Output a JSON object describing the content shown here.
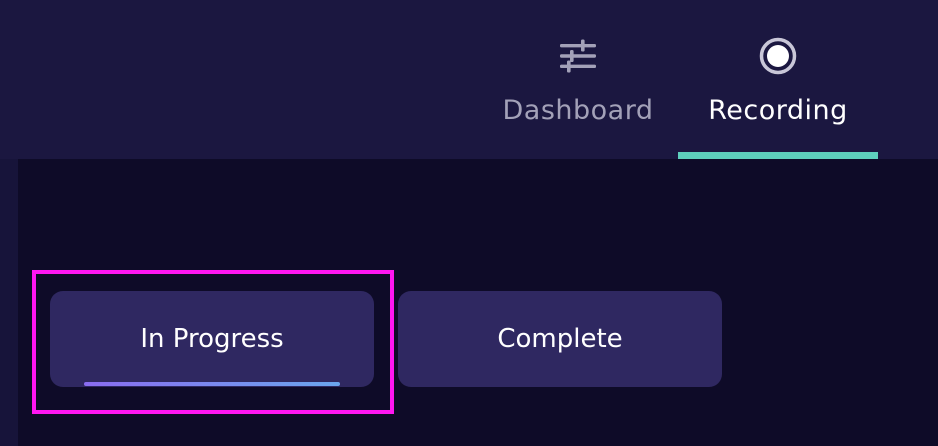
{
  "colors": {
    "topbar_bg": "#1b1740",
    "content_bg": "#0e0b28",
    "active_tab_indicator": "#5ecfbd",
    "segment_bg": "#2f2861",
    "highlight": "#ff16f2"
  },
  "nav": {
    "tabs": [
      {
        "label": "Dashboard",
        "icon": "sliders-icon",
        "active": false
      },
      {
        "label": "Recording",
        "icon": "record-icon",
        "active": true
      }
    ]
  },
  "segments": {
    "items": [
      {
        "label": "In Progress",
        "selected": true
      },
      {
        "label": "Complete",
        "selected": false
      }
    ]
  }
}
